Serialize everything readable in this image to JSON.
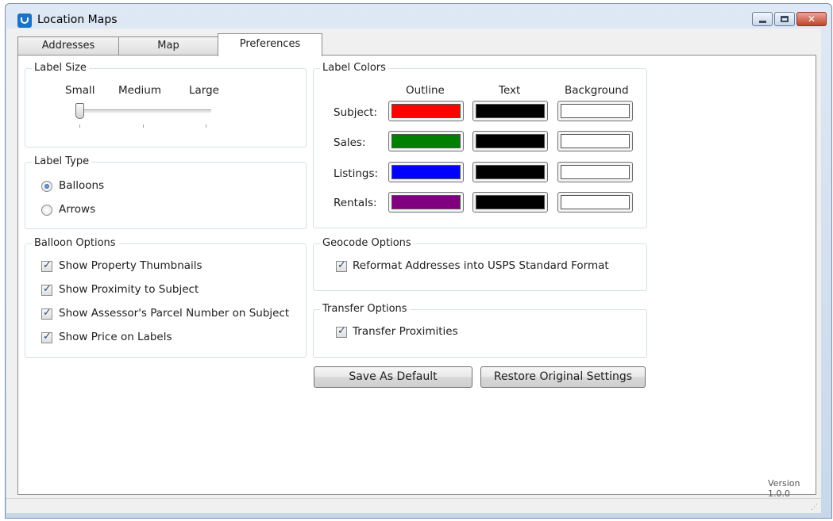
{
  "window": {
    "title": "Location Maps",
    "minimize_icon": "minimize-icon",
    "maximize_icon": "maximize-icon",
    "close_glyph": "✕"
  },
  "tabs": [
    {
      "label": "Addresses",
      "active": false
    },
    {
      "label": "Map",
      "active": false
    },
    {
      "label": "Preferences",
      "active": true
    }
  ],
  "label_size": {
    "title": "Label Size",
    "small": "Small",
    "medium": "Medium",
    "large": "Large",
    "selected": "Small"
  },
  "label_type": {
    "title": "Label Type",
    "options": [
      {
        "label": "Balloons",
        "checked": true
      },
      {
        "label": "Arrows",
        "checked": false
      }
    ]
  },
  "balloon_options": {
    "title": "Balloon Options",
    "items": [
      {
        "label": "Show Property Thumbnails",
        "checked": true
      },
      {
        "label": "Show Proximity to Subject",
        "checked": true
      },
      {
        "label": "Show Assessor's Parcel Number on Subject",
        "checked": true
      },
      {
        "label": "Show Price on Labels",
        "checked": true
      }
    ]
  },
  "label_colors": {
    "title": "Label Colors",
    "columns": [
      "Outline",
      "Text",
      "Background"
    ],
    "rows": [
      {
        "label": "Subject:",
        "outline": "#ff0000",
        "text": "#000000",
        "background": "#ffffff"
      },
      {
        "label": "Sales:",
        "outline": "#008000",
        "text": "#000000",
        "background": "#ffffff"
      },
      {
        "label": "Listings:",
        "outline": "#0000ff",
        "text": "#000000",
        "background": "#ffffff"
      },
      {
        "label": "Rentals:",
        "outline": "#800080",
        "text": "#000000",
        "background": "#ffffff"
      }
    ]
  },
  "geocode_options": {
    "title": "Geocode Options",
    "items": [
      {
        "label": "Reformat Addresses into USPS Standard Format",
        "checked": true
      }
    ]
  },
  "transfer_options": {
    "title": "Transfer Options",
    "items": [
      {
        "label": "Transfer Proximities",
        "checked": true
      }
    ]
  },
  "buttons": {
    "save_default": "Save As Default",
    "restore": "Restore Original Settings"
  },
  "version": "Version 1.0.0"
}
